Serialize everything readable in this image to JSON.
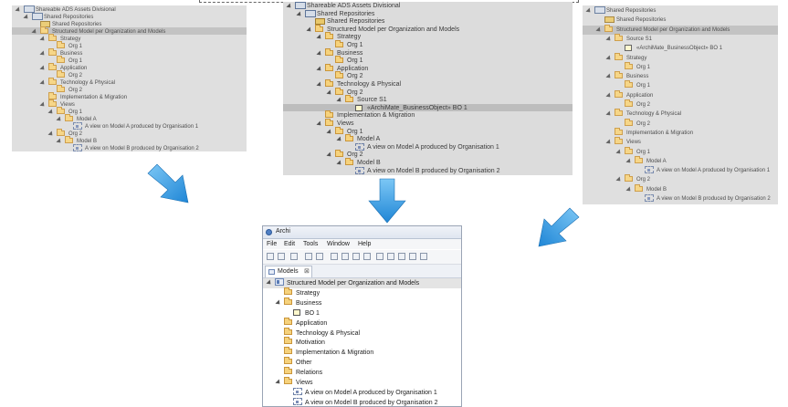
{
  "panel_left": {
    "rows": [
      {
        "depth": 0,
        "icon": "repo",
        "label": "Shareable ADS Assets Divisional",
        "twisty": true
      },
      {
        "depth": 1,
        "icon": "repo",
        "label": "Shared Repositories",
        "twisty": true
      },
      {
        "depth": 2,
        "icon": "repo-folder",
        "label": "Shared Repositories",
        "twisty": false
      },
      {
        "depth": 2,
        "icon": "folder",
        "label": "Structured Model per Organization and Models",
        "twisty": true,
        "selected": true
      },
      {
        "depth": 3,
        "icon": "folder",
        "label": "Strategy",
        "twisty": true
      },
      {
        "depth": 4,
        "icon": "folder",
        "label": "Org 1",
        "twisty": false
      },
      {
        "depth": 3,
        "icon": "folder",
        "label": "Business",
        "twisty": true
      },
      {
        "depth": 4,
        "icon": "folder",
        "label": "Org 1",
        "twisty": false
      },
      {
        "depth": 3,
        "icon": "folder",
        "label": "Application",
        "twisty": true
      },
      {
        "depth": 4,
        "icon": "folder",
        "label": "Org 2",
        "twisty": false
      },
      {
        "depth": 3,
        "icon": "folder",
        "label": "Technology & Physical",
        "twisty": true
      },
      {
        "depth": 4,
        "icon": "folder",
        "label": "Org 2",
        "twisty": false
      },
      {
        "depth": 3,
        "icon": "folder",
        "label": "Implementation & Migration",
        "twisty": false
      },
      {
        "depth": 3,
        "icon": "folder",
        "label": "Views",
        "twisty": true
      },
      {
        "depth": 4,
        "icon": "folder",
        "label": "Org 1",
        "twisty": true
      },
      {
        "depth": 5,
        "icon": "folder",
        "label": "Model A",
        "twisty": true
      },
      {
        "depth": 6,
        "icon": "view",
        "label": "A view on Model A produced by Organisation 1",
        "twisty": false
      },
      {
        "depth": 4,
        "icon": "folder",
        "label": "Org 2",
        "twisty": true
      },
      {
        "depth": 5,
        "icon": "folder",
        "label": "Model B",
        "twisty": true
      },
      {
        "depth": 6,
        "icon": "view",
        "label": "A view on Model B produced by Organisation 2",
        "twisty": false
      }
    ]
  },
  "panel_middle": {
    "rows": [
      {
        "depth": 0,
        "icon": "repo",
        "label": "Shareable ADS Assets Divisional",
        "twisty": true
      },
      {
        "depth": 1,
        "icon": "repo",
        "label": "Shared Repositories",
        "twisty": true
      },
      {
        "depth": 2,
        "icon": "repo-folder",
        "label": "Shared Repositories",
        "twisty": false
      },
      {
        "depth": 2,
        "icon": "folder",
        "label": "Structured Model per Organization and Models",
        "twisty": true
      },
      {
        "depth": 3,
        "icon": "folder",
        "label": "Strategy",
        "twisty": true
      },
      {
        "depth": 4,
        "icon": "folder",
        "label": "Org 1",
        "twisty": false
      },
      {
        "depth": 3,
        "icon": "folder",
        "label": "Business",
        "twisty": true
      },
      {
        "depth": 4,
        "icon": "folder",
        "label": "Org 1",
        "twisty": false
      },
      {
        "depth": 3,
        "icon": "folder",
        "label": "Application",
        "twisty": true
      },
      {
        "depth": 4,
        "icon": "folder",
        "label": "Org 2",
        "twisty": false
      },
      {
        "depth": 3,
        "icon": "folder",
        "label": "Technology & Physical",
        "twisty": true
      },
      {
        "depth": 4,
        "icon": "folder",
        "label": "Org 2",
        "twisty": true
      },
      {
        "depth": 5,
        "icon": "folder",
        "label": "Source S1",
        "twisty": true
      },
      {
        "depth": 6,
        "icon": "object",
        "label": "«ArchiMate_BusinessObject» BO 1",
        "twisty": false,
        "selected": true
      },
      {
        "depth": 3,
        "icon": "folder",
        "label": "Implementation & Migration",
        "twisty": false
      },
      {
        "depth": 3,
        "icon": "folder",
        "label": "Views",
        "twisty": true
      },
      {
        "depth": 4,
        "icon": "folder",
        "label": "Org 1",
        "twisty": true
      },
      {
        "depth": 5,
        "icon": "folder",
        "label": "Model A",
        "twisty": true
      },
      {
        "depth": 6,
        "icon": "view",
        "label": "A view on Model A produced by Organisation 1",
        "twisty": false
      },
      {
        "depth": 4,
        "icon": "folder",
        "label": "Org 2",
        "twisty": true
      },
      {
        "depth": 5,
        "icon": "folder",
        "label": "Model B",
        "twisty": true
      },
      {
        "depth": 6,
        "icon": "view",
        "label": "A view on Model B produced by Organisation 2",
        "twisty": false
      }
    ]
  },
  "panel_right": {
    "rows": [
      {
        "depth": 0,
        "icon": "repo",
        "label": "Shared Repositories",
        "twisty": true
      },
      {
        "depth": 1,
        "icon": "repo-folder",
        "label": "Shared Repositories",
        "twisty": false
      },
      {
        "depth": 1,
        "icon": "folder",
        "label": "Structured Model per Organization and Models",
        "twisty": true,
        "selected": true
      },
      {
        "depth": 2,
        "icon": "folder",
        "label": "Source S1",
        "twisty": true
      },
      {
        "depth": 3,
        "icon": "object",
        "label": "«ArchiMate_BusinessObject» BO 1",
        "twisty": false
      },
      {
        "depth": 2,
        "icon": "folder",
        "label": "Strategy",
        "twisty": true
      },
      {
        "depth": 3,
        "icon": "folder",
        "label": "Org 1",
        "twisty": false
      },
      {
        "depth": 2,
        "icon": "folder",
        "label": "Business",
        "twisty": true
      },
      {
        "depth": 3,
        "icon": "folder",
        "label": "Org 1",
        "twisty": false
      },
      {
        "depth": 2,
        "icon": "folder",
        "label": "Application",
        "twisty": true
      },
      {
        "depth": 3,
        "icon": "folder",
        "label": "Org 2",
        "twisty": false
      },
      {
        "depth": 2,
        "icon": "folder",
        "label": "Technology & Physical",
        "twisty": true
      },
      {
        "depth": 3,
        "icon": "folder",
        "label": "Org 2",
        "twisty": false
      },
      {
        "depth": 2,
        "icon": "folder",
        "label": "Implementation & Migration",
        "twisty": false
      },
      {
        "depth": 2,
        "icon": "folder",
        "label": "Views",
        "twisty": true
      },
      {
        "depth": 3,
        "icon": "folder",
        "label": "Org 1",
        "twisty": true
      },
      {
        "depth": 4,
        "icon": "folder",
        "label": "Model A",
        "twisty": true
      },
      {
        "depth": 5,
        "icon": "view",
        "label": "A view on Model A produced by Organisation 1",
        "twisty": false
      },
      {
        "depth": 3,
        "icon": "folder",
        "label": "Org 2",
        "twisty": true
      },
      {
        "depth": 4,
        "icon": "folder",
        "label": "Model B",
        "twisty": true
      },
      {
        "depth": 5,
        "icon": "view",
        "label": "A view on Model B produced by Organisation 2",
        "twisty": false
      }
    ]
  },
  "archi": {
    "title": "Archi",
    "menu": [
      "File",
      "Edit",
      "Tools",
      "Window",
      "Help"
    ],
    "tab_label": "Models",
    "tab_close": "⊠",
    "rows": [
      {
        "depth": 0,
        "icon": "model",
        "label": "Structured Model per Organization and Models",
        "twisty": true,
        "selected": true
      },
      {
        "depth": 1,
        "icon": "folder",
        "label": "Strategy",
        "twisty": false
      },
      {
        "depth": 1,
        "icon": "folder",
        "label": "Business",
        "twisty": true
      },
      {
        "depth": 2,
        "icon": "object",
        "label": "BO 1",
        "twisty": false
      },
      {
        "depth": 1,
        "icon": "folder",
        "label": "Application",
        "twisty": false
      },
      {
        "depth": 1,
        "icon": "folder",
        "label": "Technology & Physical",
        "twisty": false
      },
      {
        "depth": 1,
        "icon": "folder",
        "label": "Motivation",
        "twisty": false
      },
      {
        "depth": 1,
        "icon": "folder",
        "label": "Implementation & Migration",
        "twisty": false
      },
      {
        "depth": 1,
        "icon": "folder",
        "label": "Other",
        "twisty": false
      },
      {
        "depth": 1,
        "icon": "folder",
        "label": "Relations",
        "twisty": false
      },
      {
        "depth": 1,
        "icon": "folder",
        "label": "Views",
        "twisty": true
      },
      {
        "depth": 2,
        "icon": "view",
        "label": "A view on Model A produced by Organisation 1",
        "twisty": false
      },
      {
        "depth": 2,
        "icon": "view",
        "label": "A view on Model B produced by Organisation 2",
        "twisty": false
      }
    ]
  },
  "colors": {
    "arrow": "#3aa0e0",
    "panel_bg": "#dcdcdc",
    "selection": "#bdbdbd"
  }
}
